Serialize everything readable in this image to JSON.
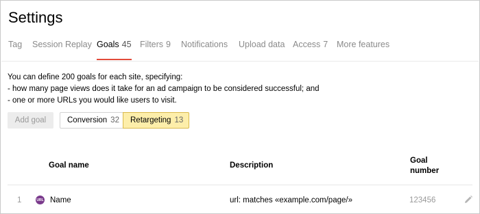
{
  "page": {
    "title": "Settings"
  },
  "tabs": [
    {
      "label": "Tag",
      "count": ""
    },
    {
      "label": "Session Replay",
      "count": ""
    },
    {
      "label": "Goals",
      "count": "45"
    },
    {
      "label": "Filters",
      "count": "9"
    },
    {
      "label": "Notifications",
      "count": ""
    },
    {
      "label": "Upload data",
      "count": ""
    },
    {
      "label": "Access",
      "count": "7"
    },
    {
      "label": "More features",
      "count": ""
    }
  ],
  "active_tab": "Goals",
  "intro": {
    "line1": "You can define 200 goals for each site, specifying:",
    "line2": "-  how many page views does it take for an ad campaign to be considered successful; and",
    "line3": "-  one or more URLs you would like users to visit."
  },
  "add_goal_label": "Add goal",
  "goal_types": {
    "conversion_label": "Conversion",
    "conversion_count": "32",
    "retargeting_label": "Retargeting",
    "retargeting_count": "13",
    "selected": "Retargeting"
  },
  "table": {
    "headers": {
      "name": "Goal name",
      "description": "Description",
      "number_line1": "Goal",
      "number_line2": "number"
    },
    "rows": [
      {
        "index": "1",
        "icon": "url-goal-icon",
        "icon_text": "URL",
        "name": "Name",
        "description": "url: matches «example.com/page/»",
        "number": "123456"
      }
    ]
  },
  "colors": {
    "active_tab_underline": "#e24a3a",
    "selected_segment_bg": "#fdeeaa",
    "goal_icon_bg": "#7a3a8c"
  }
}
